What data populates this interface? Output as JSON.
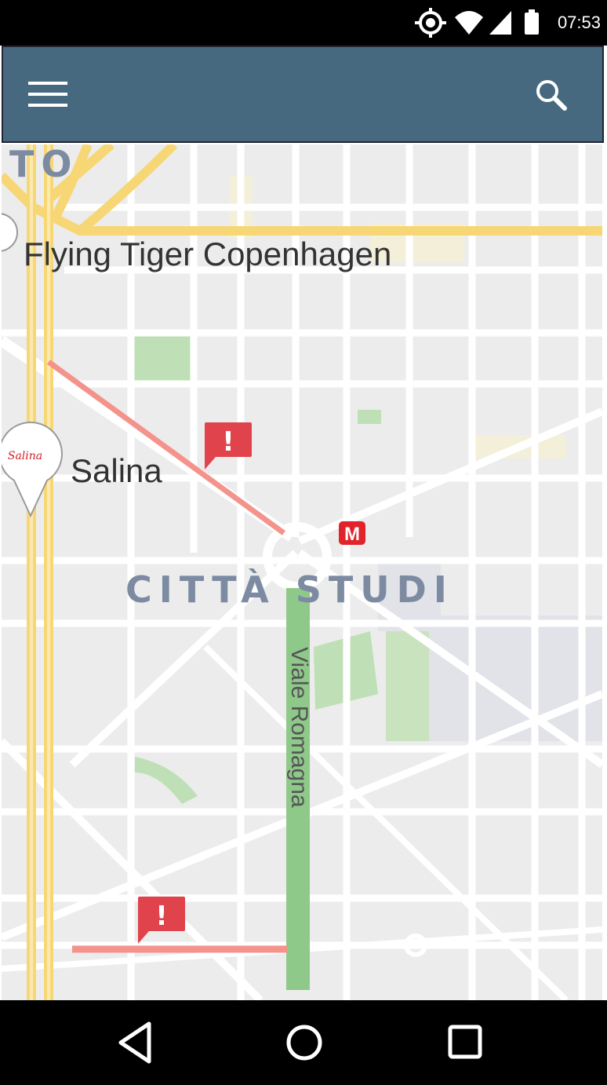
{
  "status_bar": {
    "time": "07:53",
    "icons": [
      "gps-icon",
      "wifi-icon",
      "signal-icon",
      "battery-icon"
    ]
  },
  "app_bar": {
    "menu_icon": "menu-icon",
    "search_icon": "search-icon",
    "color": "#47697f"
  },
  "map": {
    "labels": {
      "poi_1": "Flying Tiger Copenhagen",
      "poi_2": "Salina",
      "poi_2_logo_text": "Salina",
      "district": "CITTÀ STUDI",
      "district_partial": "TO",
      "street": "Viale Romagna",
      "metro": "M"
    },
    "alerts": [
      {
        "icon": "alert-icon",
        "symbol": "!"
      },
      {
        "icon": "alert-icon",
        "symbol": "!"
      }
    ],
    "colors": {
      "alert_route": "#f4938c",
      "alert_marker": "#e0434b",
      "highlight_street": "#8fc98a",
      "major_road": "#f7d775",
      "metro": "#e0242a"
    }
  },
  "nav_bar": {
    "back_icon": "back-triangle-icon",
    "home_icon": "home-circle-icon",
    "recents_icon": "recents-square-icon"
  }
}
